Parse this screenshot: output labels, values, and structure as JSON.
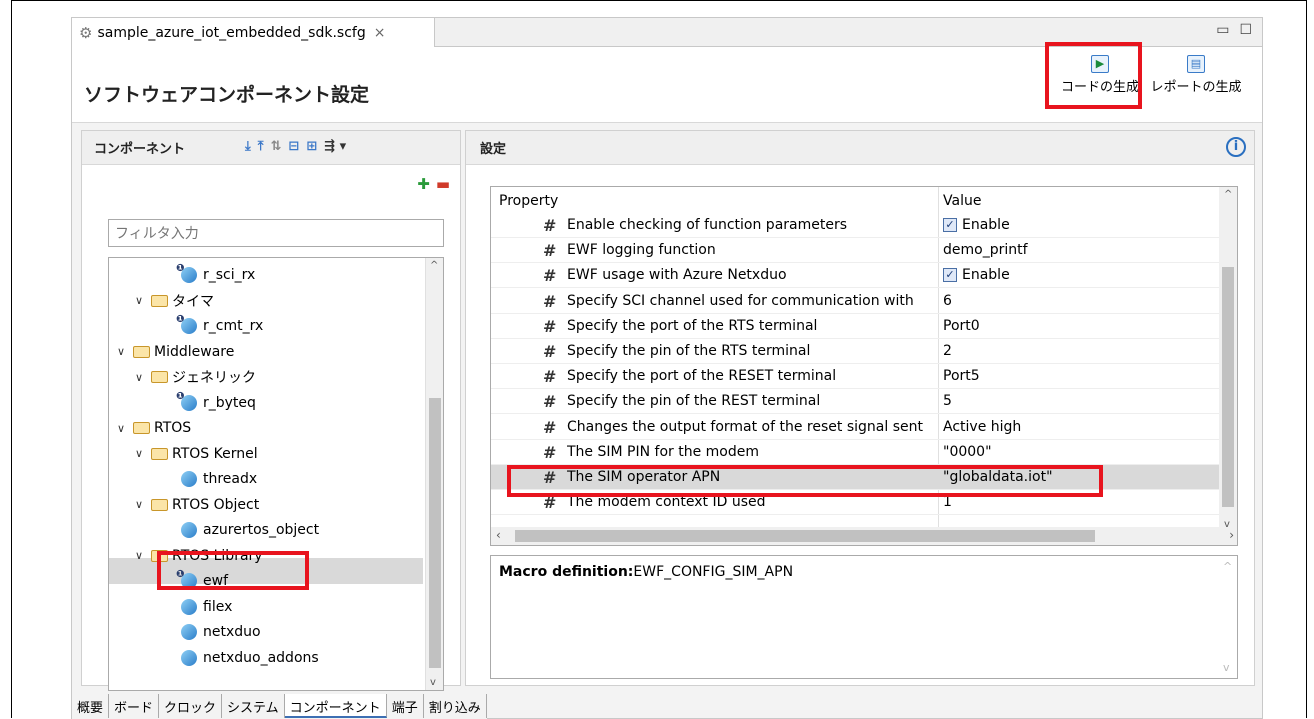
{
  "tab": {
    "file_name": "sample_azure_iot_embedded_sdk.scfg",
    "close": "×"
  },
  "window": {
    "minimize": "▭",
    "maximize": "☐"
  },
  "header": {
    "title": "ソフトウェアコンポーネント設定",
    "generate_code_label": "コードの生成",
    "generate_report_label": "レポートの生成"
  },
  "left": {
    "title": "コンポーネント",
    "filter_placeholder": "フィルタ入力",
    "tree": [
      {
        "label": "r_sci_rx",
        "kind": "component-warn",
        "depth": 3
      },
      {
        "label": "タイマ",
        "kind": "folder",
        "depth": 1
      },
      {
        "label": "r_cmt_rx",
        "kind": "component-warn",
        "depth": 3
      },
      {
        "label": "Middleware",
        "kind": "folder",
        "depth": 0
      },
      {
        "label": "ジェネリック",
        "kind": "folder",
        "depth": 1
      },
      {
        "label": "r_byteq",
        "kind": "component-warn",
        "depth": 3
      },
      {
        "label": "RTOS",
        "kind": "folder",
        "depth": 0
      },
      {
        "label": "RTOS Kernel",
        "kind": "folder",
        "depth": 1
      },
      {
        "label": "threadx",
        "kind": "component",
        "depth": 3
      },
      {
        "label": "RTOS Object",
        "kind": "folder",
        "depth": 1
      },
      {
        "label": "azurertos_object",
        "kind": "component",
        "depth": 3
      },
      {
        "label": "RTOS Library",
        "kind": "folder",
        "depth": 1
      },
      {
        "label": "ewf",
        "kind": "component-warn",
        "depth": 3
      },
      {
        "label": "filex",
        "kind": "component",
        "depth": 3
      },
      {
        "label": "netxduo",
        "kind": "component",
        "depth": 3
      },
      {
        "label": "netxduo_addons",
        "kind": "component",
        "depth": 3
      }
    ]
  },
  "right": {
    "title": "設定",
    "columns": {
      "property": "Property",
      "value": "Value"
    },
    "rows": [
      {
        "name": "Enable checking of function parameters",
        "value": "Enable",
        "checkbox": true
      },
      {
        "name": "EWF logging function",
        "value": "demo_printf",
        "checkbox": false
      },
      {
        "name": "EWF usage with Azure Netxduo",
        "value": "Enable",
        "checkbox": true
      },
      {
        "name": "Specify SCI channel used for communication with",
        "value": "6",
        "checkbox": false
      },
      {
        "name": "Specify the port of the RTS terminal",
        "value": "Port0",
        "checkbox": false
      },
      {
        "name": "Specify the pin of the RTS terminal",
        "value": "2",
        "checkbox": false
      },
      {
        "name": "Specify the port of the RESET terminal",
        "value": "Port5",
        "checkbox": false
      },
      {
        "name": "Specify the pin of the REST terminal",
        "value": "5",
        "checkbox": false
      },
      {
        "name": "Changes the output format of the reset signal sent",
        "value": "Active high",
        "checkbox": false
      },
      {
        "name": "The SIM PIN for the modem",
        "value": "\"0000\"",
        "checkbox": false
      },
      {
        "name": "The SIM operator APN",
        "value": "\"globaldata.iot\"",
        "checkbox": false
      },
      {
        "name": "The modem context ID used",
        "value": "1",
        "checkbox": false
      }
    ],
    "macro_label": "Macro definition:",
    "macro_value": "EWF_CONFIG_SIM_APN"
  },
  "bottom_tabs": [
    "概要",
    "ボード",
    "クロック",
    "システム",
    "コンポーネント",
    "端子",
    "割り込み"
  ],
  "colors": {
    "highlight_red": "#e8141e",
    "selection_gray": "#d9d9d9"
  }
}
